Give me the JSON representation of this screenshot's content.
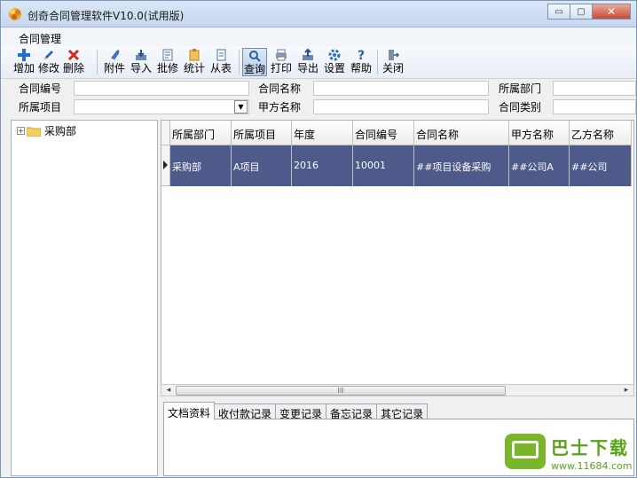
{
  "window": {
    "title": "创奇合同管理软件V10.0(试用版)",
    "minimize_glyph": "▭",
    "maximize_glyph": "▢",
    "close_glyph": "✕"
  },
  "menu": {
    "contract_mgmt": "合同管理"
  },
  "toolbar": {
    "add": "增加",
    "edit": "修改",
    "delete": "删除",
    "attachment": "附件",
    "import": "导入",
    "approve": "批修",
    "stats": "统计",
    "from_table": "从表",
    "query": "查询",
    "print": "打印",
    "export": "导出",
    "settings": "设置",
    "help": "帮助",
    "close": "关闭"
  },
  "filters": {
    "contract_no_label": "合同编号",
    "contract_name_label": "合同名称",
    "department_label": "所属部门",
    "project_label": "所属项目",
    "party_a_label": "甲方名称",
    "contract_type_label": "合同类别",
    "dropdown_glyph": "▼"
  },
  "tree": {
    "expander": "+",
    "root": "采购部"
  },
  "grid": {
    "headers": [
      "所属部门",
      "所属项目",
      "年度",
      "合同编号",
      "合同名称",
      "甲方名称",
      "乙方名称"
    ],
    "rows": [
      [
        "采购部",
        "A项目",
        "2016",
        "10001",
        "##项目设备采购",
        "##公司A",
        "##公司"
      ]
    ]
  },
  "scrollbar": {
    "left_arrow": "◂",
    "right_arrow": "▸",
    "grip": "III"
  },
  "tabs": [
    "文档资料",
    "收付款记录",
    "变更记录",
    "备忘记录",
    "其它记录"
  ],
  "watermark": {
    "title": "巴士下载",
    "url": "www.11684.com"
  },
  "colors": {
    "selected_row": "#4d5a8a",
    "accent": "#6f8fb8"
  }
}
